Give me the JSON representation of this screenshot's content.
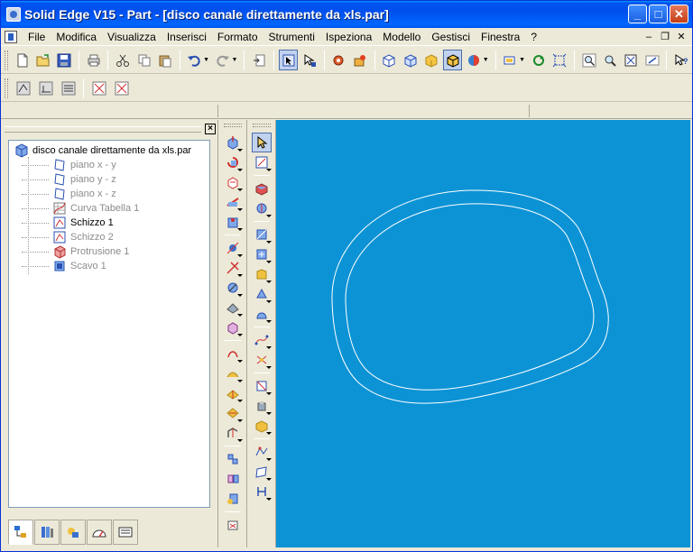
{
  "window": {
    "title": "Solid Edge V15 - Part - [disco canale direttamente da xls.par]",
    "controls": {
      "minimize": "_",
      "maximize": "□",
      "close": "✕"
    }
  },
  "menubar": {
    "items": [
      {
        "label": "File"
      },
      {
        "label": "Modifica"
      },
      {
        "label": "Visualizza"
      },
      {
        "label": "Inserisci"
      },
      {
        "label": "Formato"
      },
      {
        "label": "Strumenti"
      },
      {
        "label": "Ispeziona"
      },
      {
        "label": "Modello"
      },
      {
        "label": "Gestisci"
      },
      {
        "label": "Finestra"
      },
      {
        "label": "?"
      }
    ],
    "mdi_controls": {
      "minimize": "–",
      "restore": "❐",
      "close": "✕"
    }
  },
  "toolbar_main": {
    "icons": [
      "new-icon",
      "open-icon",
      "save-icon",
      "print-icon",
      "cut-icon",
      "copy-icon",
      "paste-icon",
      "undo-icon",
      "redo-icon",
      "insert-icon",
      "select-tool-icon",
      "select-manager-icon",
      "feature-library-icon",
      "parts-library-icon",
      "view-iso-icon",
      "view-top-icon",
      "shaded-icon",
      "shaded-edges-icon",
      "render-icon",
      "view-orient-icon",
      "rotate-icon",
      "fit-icon",
      "zoom-area-icon",
      "zoom-icon",
      "zoom-fit-icon",
      "pan-icon",
      "help-icon"
    ]
  },
  "toolbar_second": {
    "icons": [
      "sketch-icon",
      "profile-icon",
      "table-icon",
      "relation-icon",
      "dimension-icon"
    ]
  },
  "feature_pathfinder": {
    "root": "disco canale direttamente da xls.par",
    "items": [
      {
        "label": "piano x - y",
        "state": "dim",
        "icon": "plane-icon"
      },
      {
        "label": "piano y - z",
        "state": "dim",
        "icon": "plane-icon"
      },
      {
        "label": "piano x - z",
        "state": "dim",
        "icon": "plane-icon"
      },
      {
        "label": "Curva Tabella 1",
        "state": "dim",
        "icon": "table-curve-icon"
      },
      {
        "label": "Schizzo 1",
        "state": "active",
        "icon": "sketch-icon"
      },
      {
        "label": "Schizzo 2",
        "state": "dim",
        "icon": "sketch-icon"
      },
      {
        "label": "Protrusione 1",
        "state": "dim",
        "icon": "protrusion-icon"
      },
      {
        "label": "Scavo 1",
        "state": "dim",
        "icon": "cutout-icon"
      }
    ],
    "tabs": [
      "feature-tree-icon",
      "library-icon",
      "layers-icon",
      "sensors-icon",
      "family-icon"
    ]
  },
  "colors": {
    "canvas": "#0c93d5",
    "titlebar": "#0053ee",
    "curve": "#ffffff"
  }
}
